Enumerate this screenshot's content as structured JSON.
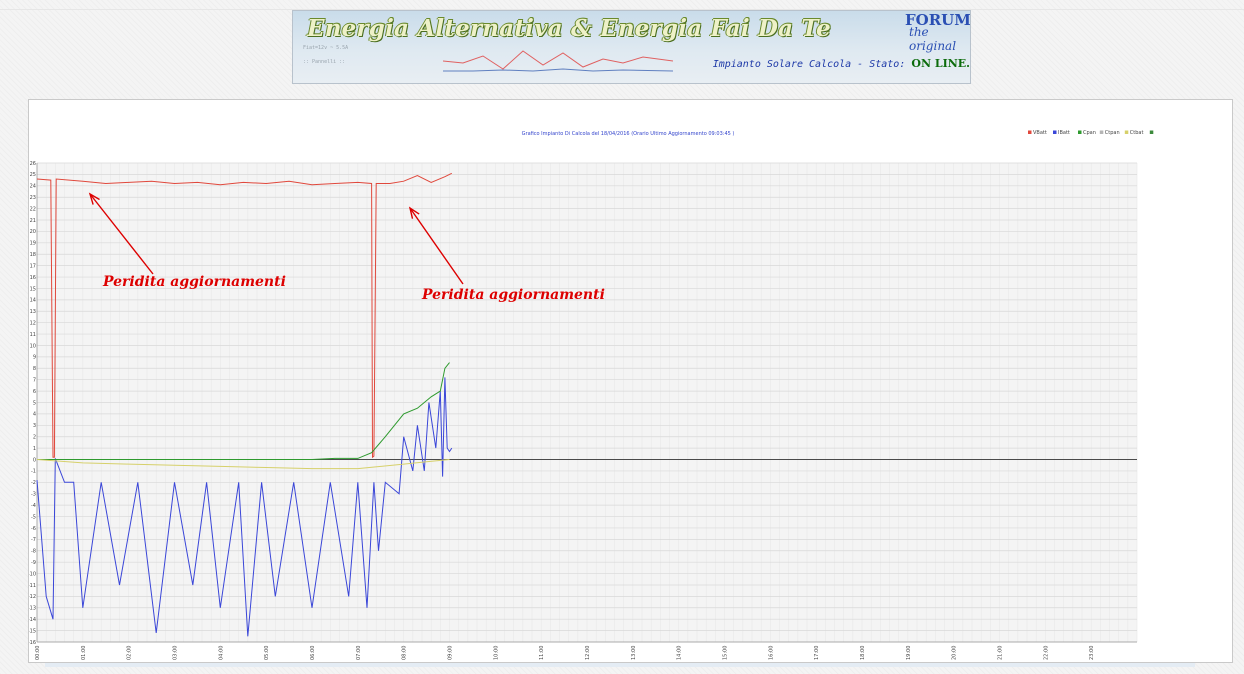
{
  "banner": {
    "title": "Energia Alternativa & Energia Fai Da Te",
    "forum_label": "FORUM",
    "forum_sub": "the original",
    "status_prefix": "Impianto Solare Calcola - Stato:",
    "status_value": "ON LINE."
  },
  "chart_data": {
    "type": "line",
    "title": "Grafico Impianto Di Calcola del 18/04/2016 (Orario Ultimo Aggiornamento 09:03:45 )",
    "legend_position": "top-right",
    "grid": true,
    "ylim": [
      -16,
      26
    ],
    "yticks": [
      26,
      25,
      24,
      23,
      22,
      21,
      20,
      19,
      18,
      17,
      16,
      15,
      14,
      13,
      12,
      11,
      10,
      9,
      8,
      7,
      6,
      5,
      4,
      3,
      2,
      1,
      0,
      -1,
      -2,
      -3,
      -4,
      -5,
      -6,
      -7,
      -8,
      -9,
      -10,
      -11,
      -12,
      -13,
      -14,
      -15,
      -16
    ],
    "xlim": [
      0,
      24
    ],
    "xticks": [
      "00:00",
      "01:00",
      "02:00",
      "03:00",
      "04:00",
      "05:00",
      "06:00",
      "07:00",
      "08:00",
      "09:00",
      "10:00",
      "11:00",
      "12:00",
      "13:00",
      "14:00",
      "15:00",
      "16:00",
      "17:00",
      "18:00",
      "19:00",
      "20:00",
      "21:00",
      "22:00",
      "23:00"
    ],
    "legend": [
      {
        "name": "VBatt",
        "color": "#e0483c"
      },
      {
        "name": "IBatt",
        "color": "#3a46d8"
      },
      {
        "name": "Cpan",
        "color": "#2e9a2e"
      },
      {
        "name": "Ctpan",
        "color": "#b5b5b5"
      },
      {
        "name": "Ctbat",
        "color": "#d6d06a"
      },
      {
        "name": "",
        "color": "#3c8a3c"
      }
    ],
    "series": [
      {
        "name": "VBatt",
        "color": "#e0483c",
        "x": [
          0,
          0.3,
          0.35,
          0.38,
          0.42,
          1.0,
          1.5,
          2.0,
          2.5,
          3.0,
          3.5,
          4.0,
          4.5,
          5.0,
          5.5,
          6.0,
          6.5,
          7.0,
          7.3,
          7.32,
          7.35,
          7.4,
          7.7,
          8.0,
          8.3,
          8.6,
          8.9,
          9.05
        ],
        "y": [
          24.6,
          24.5,
          0.2,
          0.2,
          24.6,
          24.4,
          24.2,
          24.3,
          24.4,
          24.2,
          24.3,
          24.1,
          24.3,
          24.2,
          24.4,
          24.1,
          24.2,
          24.3,
          24.2,
          0.2,
          0.3,
          24.2,
          24.2,
          24.4,
          24.9,
          24.3,
          24.8,
          25.1
        ]
      },
      {
        "name": "IBatt",
        "color": "#3a46d8",
        "x": [
          0,
          0.2,
          0.35,
          0.4,
          0.6,
          0.8,
          1.0,
          1.4,
          1.8,
          2.2,
          2.6,
          3.0,
          3.4,
          3.7,
          4.0,
          4.4,
          4.6,
          4.9,
          5.2,
          5.6,
          6.0,
          6.4,
          6.8,
          7.0,
          7.2,
          7.35,
          7.45,
          7.6,
          7.9,
          8.0,
          8.2,
          8.3,
          8.45,
          8.55,
          8.7,
          8.8,
          8.85,
          8.9,
          8.95,
          9.0,
          9.05
        ],
        "y": [
          -1.8,
          -12.0,
          -14.0,
          0.1,
          -2.0,
          -2.0,
          -13.0,
          -2.0,
          -11.0,
          -2.0,
          -15.2,
          -2.0,
          -11.0,
          -2.0,
          -13.0,
          -2.0,
          -15.5,
          -2.0,
          -12.0,
          -2.0,
          -13.0,
          -2.0,
          -12.0,
          -2.0,
          -13.0,
          -2.0,
          -8.0,
          -2.0,
          -3.0,
          2.0,
          -1.0,
          3.0,
          -1.0,
          5.0,
          1.0,
          6.0,
          -1.5,
          7.2,
          1.0,
          0.7,
          1.0
        ]
      },
      {
        "name": "Cpan",
        "color": "#2e9a2e",
        "x": [
          0,
          1,
          2,
          3,
          4,
          5,
          6,
          6.5,
          7.0,
          7.3,
          7.6,
          8.0,
          8.3,
          8.6,
          8.8,
          8.9,
          9.0
        ],
        "y": [
          0.0,
          0.0,
          0.0,
          0.0,
          0.0,
          0.0,
          0.0,
          0.1,
          0.1,
          0.6,
          2.0,
          4.0,
          4.5,
          5.5,
          6.0,
          8.0,
          8.5
        ]
      },
      {
        "name": "Ctbat",
        "color": "#d6d06a",
        "x": [
          0,
          1,
          2,
          3,
          4,
          5,
          6,
          7,
          7.5,
          8.0,
          8.5,
          9.0
        ],
        "y": [
          0.0,
          -0.3,
          -0.4,
          -0.5,
          -0.6,
          -0.7,
          -0.8,
          -0.8,
          -0.6,
          -0.4,
          -0.2,
          0.0
        ]
      }
    ],
    "annotations": [
      {
        "text": "Peridita aggiornamenti",
        "color": "#dd0000"
      },
      {
        "text": "Peridita aggiornamenti",
        "color": "#dd0000"
      }
    ]
  }
}
